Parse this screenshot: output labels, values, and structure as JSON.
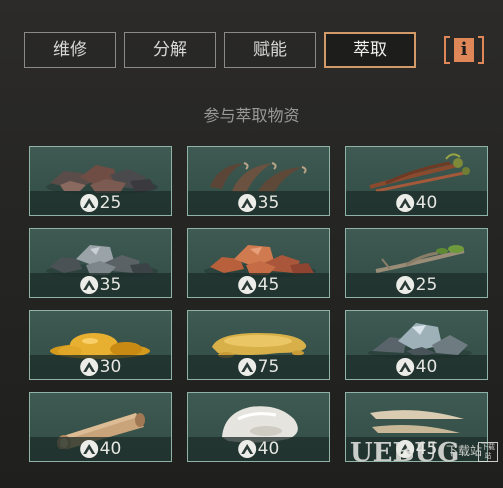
{
  "tabs": [
    {
      "label": "维修",
      "active": false
    },
    {
      "label": "分解",
      "active": false
    },
    {
      "label": "赋能",
      "active": false
    },
    {
      "label": "萃取",
      "active": true
    }
  ],
  "info_button": {
    "label": "i"
  },
  "section_title": "参与萃取物资",
  "colors": {
    "accent": "#d29a68",
    "info": "#e0875a",
    "card_bg": "#3e5a52",
    "card_border": "#8fb3a6"
  },
  "items": [
    {
      "icon": "dark-ore-icon",
      "level": "25"
    },
    {
      "icon": "claws-icon",
      "level": "35"
    },
    {
      "icon": "root-herb-icon",
      "level": "40"
    },
    {
      "icon": "metal-ore-icon",
      "level": "35"
    },
    {
      "icon": "copper-ore-icon",
      "level": "45"
    },
    {
      "icon": "branch-icon",
      "level": "25"
    },
    {
      "icon": "amber-resin-icon",
      "level": "30"
    },
    {
      "icon": "golden-liquid-icon",
      "level": "75"
    },
    {
      "icon": "crystal-rock-icon",
      "level": "40"
    },
    {
      "icon": "wood-log-icon",
      "level": "40"
    },
    {
      "icon": "white-fat-icon",
      "level": "40"
    },
    {
      "icon": "fang-icon",
      "level": "45"
    }
  ],
  "watermark": {
    "text": "UEBUG",
    "sub": "下载站",
    "tag": "下载站"
  }
}
